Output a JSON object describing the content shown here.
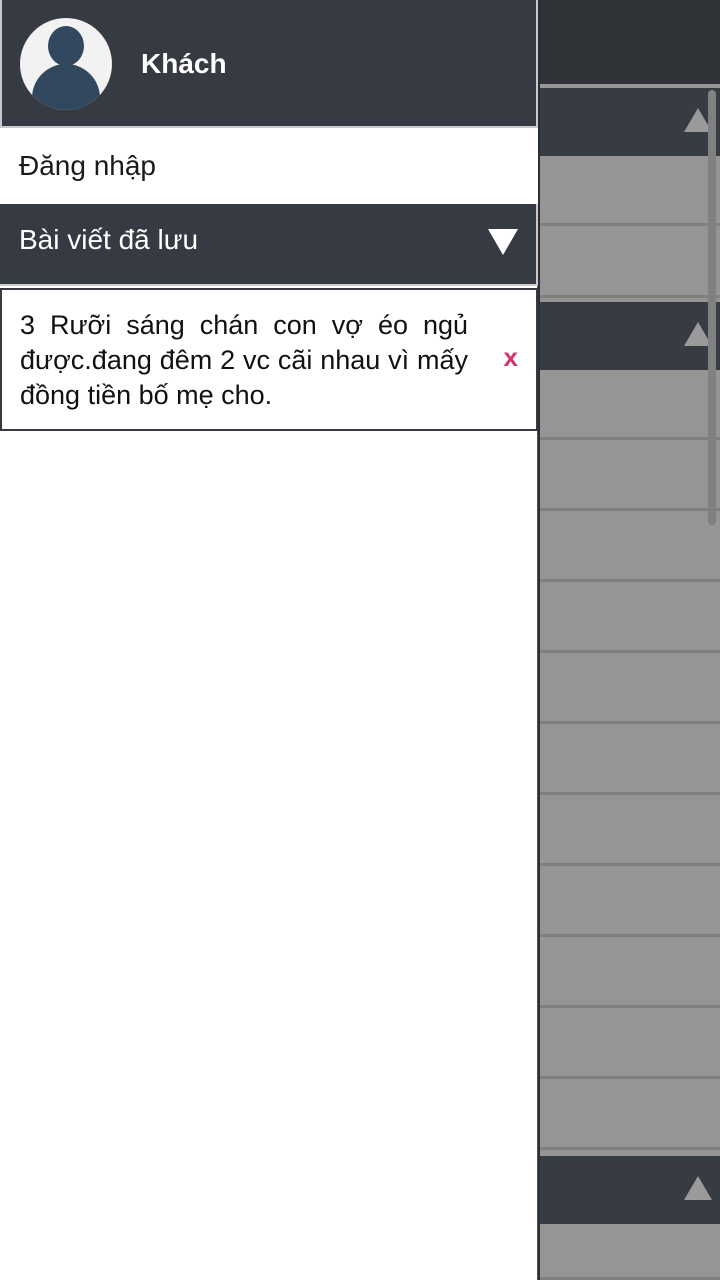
{
  "drawer": {
    "profile": {
      "name": "Khách",
      "avatar_icon": "user-avatar-icon"
    },
    "login_label": "Đăng nhập",
    "saved_section": {
      "title": "Bài viết đã lưu",
      "toggle_icon": "triangle-down-icon",
      "items": [
        {
          "text": "3 Rưỡi sáng chán con vợ éo ngủ được.đang đêm 2 vc cãi nhau vì mấy đồng tiền bố mẹ cho.",
          "remove_label": "x"
        }
      ]
    }
  },
  "colors": {
    "header_bg": "#363a42",
    "remove_accent": "#d6336c",
    "background_list": "#959595"
  }
}
